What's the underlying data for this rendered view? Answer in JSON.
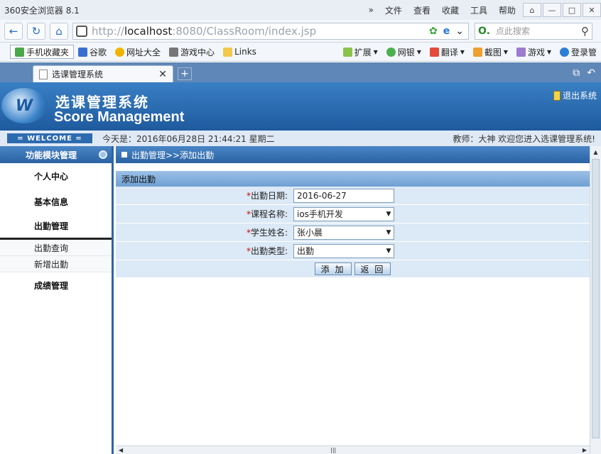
{
  "browser": {
    "title": "360安全浏览器 8.1",
    "menus": [
      "»",
      "文件",
      "查看",
      "收藏",
      "工具",
      "帮助"
    ],
    "url_dim_prefix": "http://",
    "url_host": "localhost",
    "url_rest": ":8080/ClassRoom/index.jsp",
    "search_placeholder": "点此搜索",
    "favorites": [
      "手机收藏夹",
      "谷歌",
      "网址大全",
      "游戏中心",
      "Links"
    ],
    "favorites_right": [
      "扩展",
      "网银",
      "翻译",
      "截图",
      "游戏",
      "登录管"
    ],
    "tab_title": "选课管理系统"
  },
  "header": {
    "title_cn": "选课管理系统",
    "title_en": "Score Management",
    "logout": "退出系统",
    "welcome_tag": "= WELCOME =",
    "date_text": "今天是：2016年06月28日   21:44:21   星期二",
    "teacher_text": "教师：大神   欢迎您进入选课管理系统!"
  },
  "sidebar": {
    "heading": "功能模块管理",
    "groups": [
      "个人中心",
      "基本信息",
      "出勤管理",
      "成绩管理"
    ],
    "sub_items": [
      "出勤查询",
      "新增出勤"
    ]
  },
  "main": {
    "breadcrumb": "出勤管理>>添加出勤",
    "panel_title": "添加出勤",
    "form": [
      {
        "label": "出勤日期:",
        "value": "2016-06-27",
        "dropdown": false
      },
      {
        "label": "课程名称:",
        "value": "ios手机开发",
        "dropdown": true
      },
      {
        "label": "学生姓名:",
        "value": "张小晨",
        "dropdown": true
      },
      {
        "label": "出勤类型:",
        "value": "出勤",
        "dropdown": true
      }
    ],
    "add_button": "添 加",
    "back_button": "返 回"
  },
  "icons": [
    "back-icon",
    "refresh-icon",
    "home-icon",
    "shield-icon",
    "search-icon",
    "close-icon",
    "add-tab-icon"
  ]
}
